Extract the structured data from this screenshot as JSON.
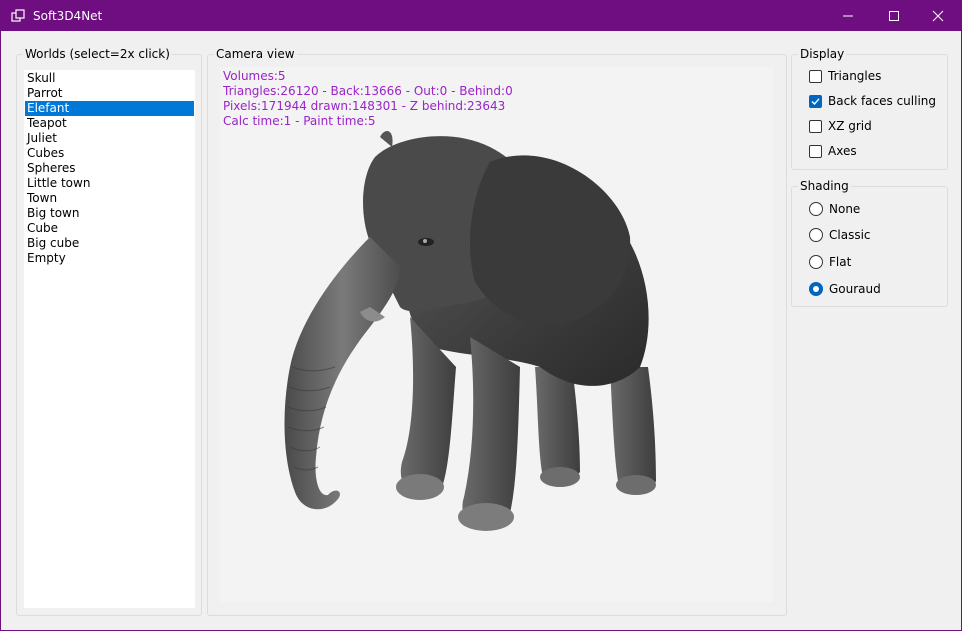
{
  "window": {
    "title": "Soft3D4Net",
    "accent": "#6f0e80"
  },
  "worlds": {
    "legend": "Worlds (select=2x click)",
    "items": [
      "Skull",
      "Parrot",
      "Elefant",
      "Teapot",
      "Juliet",
      "Cubes",
      "Spheres",
      "Little town",
      "Town",
      "Big town",
      "Cube",
      "Big cube",
      "Empty"
    ],
    "selected": "Elefant"
  },
  "camera": {
    "legend": "Camera view",
    "stats": [
      "Volumes:5",
      "Triangles:26120 - Back:13666 - Out:0 - Behind:0",
      "Pixels:171944 drawn:148301 - Z behind:23643",
      "Calc time:1 - Paint time:5"
    ],
    "stats_color": "#9b24c7",
    "model": "elephant"
  },
  "display": {
    "legend": "Display",
    "options": [
      {
        "label": "Triangles",
        "checked": false
      },
      {
        "label": "Back faces culling",
        "checked": true
      },
      {
        "label": "XZ grid",
        "checked": false
      },
      {
        "label": "Axes",
        "checked": false
      }
    ]
  },
  "shading": {
    "legend": "Shading",
    "options": [
      {
        "label": "None",
        "checked": false
      },
      {
        "label": "Classic",
        "checked": false
      },
      {
        "label": "Flat",
        "checked": false
      },
      {
        "label": "Gouraud",
        "checked": true
      }
    ]
  }
}
